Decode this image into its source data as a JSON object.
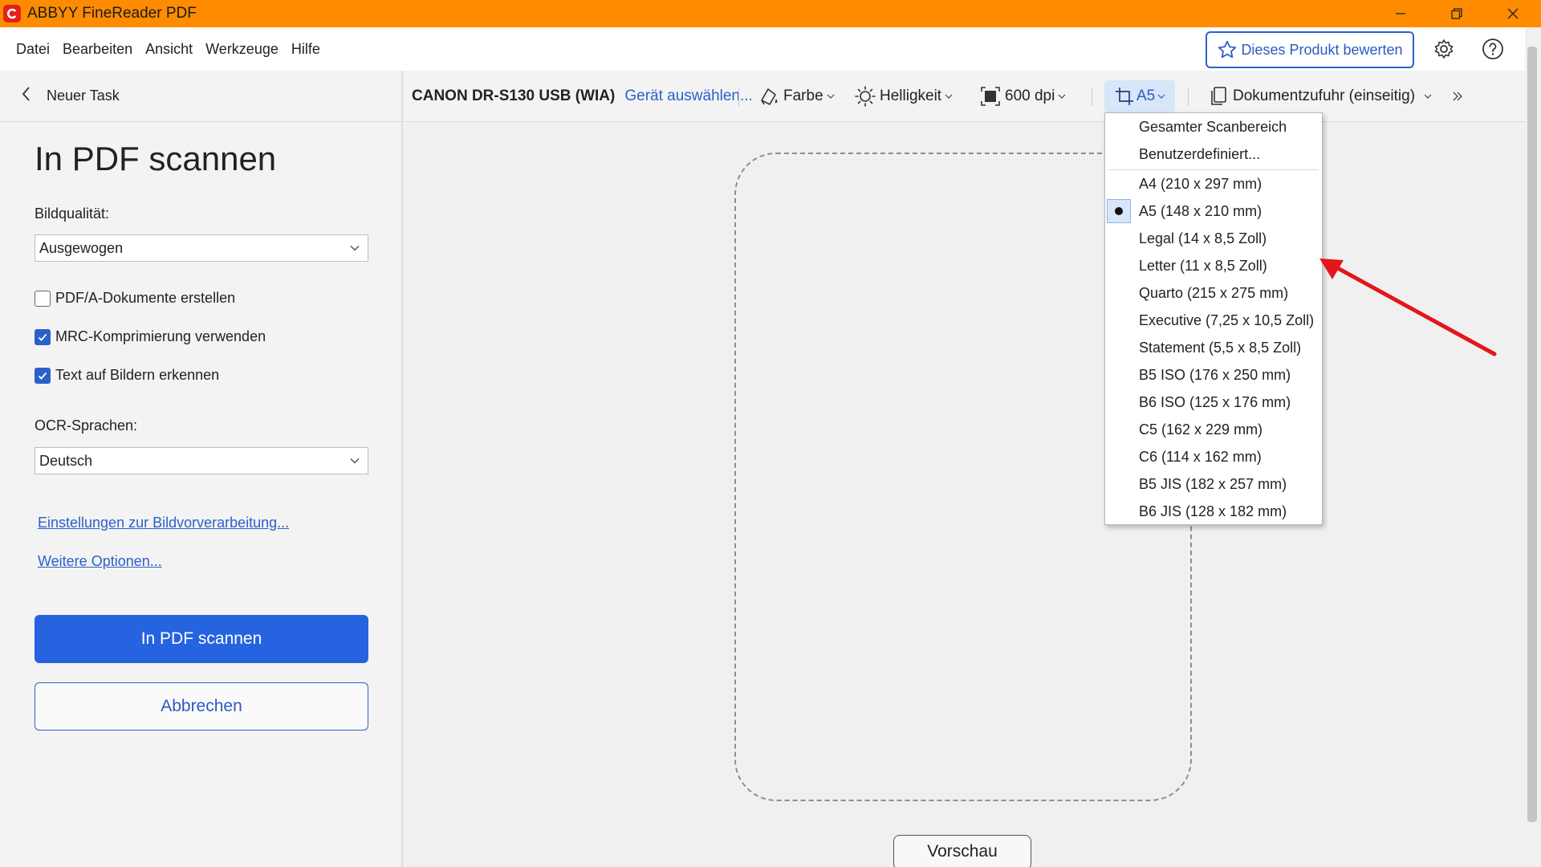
{
  "window": {
    "title": "ABBYY FineReader PDF"
  },
  "menu": {
    "items": [
      "Datei",
      "Bearbeiten",
      "Ansicht",
      "Werkzeuge",
      "Hilfe"
    ],
    "rate_button": "Dieses Produkt bewerten"
  },
  "left_panel": {
    "back_label": "Neuer Task",
    "title": "In PDF scannen",
    "image_quality_label": "Bildqualität:",
    "image_quality_value": "Ausgewogen",
    "checkboxes": [
      {
        "label": "PDF/A-Dokumente erstellen",
        "checked": false
      },
      {
        "label": "MRC-Komprimierung verwenden",
        "checked": true
      },
      {
        "label": "Text auf Bildern erkennen",
        "checked": true
      }
    ],
    "ocr_label": "OCR-Sprachen:",
    "ocr_value": "Deutsch",
    "link_preprocessing": "Einstellungen zur Bildvorverarbeitung...",
    "link_more_options": "Weitere Optionen...",
    "scan_button": "In PDF scannen",
    "cancel_button": "Abbrechen"
  },
  "toolbar": {
    "device_name": "CANON DR-S130 USB (WIA)",
    "select_device": "Gerät auswählen...",
    "color": "Farbe",
    "brightness": "Helligkeit",
    "resolution": "600 dpi",
    "page_size": "A5",
    "feeder": "Dokumentzufuhr (einseitig)"
  },
  "page_size_menu": {
    "top_items": [
      "Gesamter Scanbereich",
      "Benutzerdefiniert..."
    ],
    "sizes": [
      "A4 (210 x 297 mm)",
      "A5 (148 x 210 mm)",
      "Legal (14 x 8,5 Zoll)",
      "Letter (11 x 8,5 Zoll)",
      "Quarto (215 x 275 mm)",
      "Executive (7,25 x 10,5 Zoll)",
      "Statement (5,5 x 8,5 Zoll)",
      "B5 ISO (176 x 250 mm)",
      "B6 ISO (125 x 176 mm)",
      "C5 (162 x 229 mm)",
      "C6 (114 x 162 mm)",
      "B5 JIS (182 x 257 mm)",
      "B6 JIS (128 x 182 mm)"
    ],
    "selected": "A5 (148 x 210 mm)"
  },
  "preview": {
    "button": "Vorschau"
  },
  "colors": {
    "titlebar": "#ff8c00",
    "accent": "#2563e0",
    "annotation_arrow": "#e3161c"
  }
}
